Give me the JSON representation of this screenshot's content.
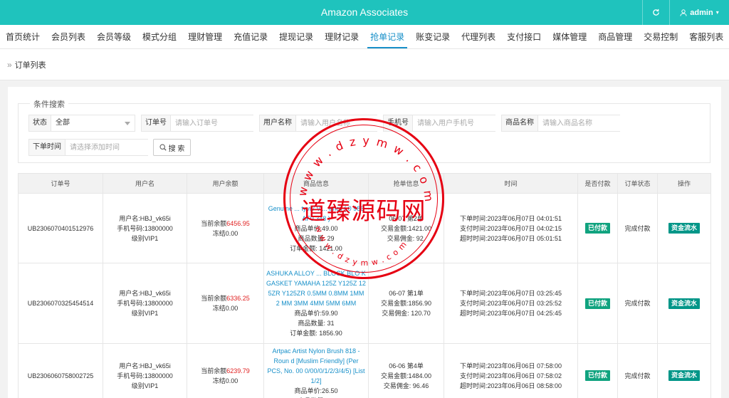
{
  "header": {
    "title": "Amazon Associates",
    "user": "admin"
  },
  "nav": [
    {
      "label": "首页统计"
    },
    {
      "label": "会员列表"
    },
    {
      "label": "会员等级"
    },
    {
      "label": "模式分组"
    },
    {
      "label": "理财管理"
    },
    {
      "label": "充值记录"
    },
    {
      "label": "提现记录"
    },
    {
      "label": "理财记录"
    },
    {
      "label": "抢单记录",
      "active": true
    },
    {
      "label": "账变记录"
    },
    {
      "label": "代理列表"
    },
    {
      "label": "支付接口"
    },
    {
      "label": "媒体管理"
    },
    {
      "label": "商品管理"
    },
    {
      "label": "交易控制"
    },
    {
      "label": "客服列表"
    }
  ],
  "breadcrumb": "订单列表",
  "search": {
    "legend": "条件搜索",
    "status_label": "状态",
    "status_value": "全部",
    "order_label": "订单号",
    "order_placeholder": "请输入订单号",
    "user_label": "用户名称",
    "user_placeholder": "请输入用户名称",
    "phone_label": "手机号",
    "phone_placeholder": "请输入用户手机号",
    "product_label": "商品名称",
    "product_placeholder": "请输入商品名称",
    "time_label": "下单时间",
    "time_placeholder": "请选择添加时间",
    "button": "搜 索"
  },
  "table": {
    "headers": [
      "订单号",
      "用户名",
      "用户余额",
      "商品信息",
      "抢单信息",
      "时间",
      "是否付款",
      "订单状态",
      "操作"
    ],
    "rows": [
      {
        "order_no": "UB2306070401512976",
        "user_name": "用户名:HBJ_vk65i",
        "user_phone": "手机号码:13800000",
        "user_level": "级别VIP1",
        "balance_label": "当前余额",
        "balance": "6456.95",
        "frozen": "冻结0.00",
        "product_title": "Genuine ... tyvi / Vi... ancil ( 0 986 AF0 348 )",
        "unit_price": "商品单价:49.00",
        "qty": "商品数量:  29",
        "amount": "订单金额:  1421.00",
        "grab_line1": "06-07 第2单",
        "grab_line2": "交易金额:1421.00",
        "grab_line3": "交易佣金:  92.",
        "t1": "下单时间:2023年06月07日 04:01:51",
        "t2": "支付时间:2023年06月07日 04:02:15",
        "t3": "超时时间:2023年06月07日 05:01:51",
        "paid": "已付款",
        "status": "完成付款",
        "action": "资金流水"
      },
      {
        "order_no": "UB2306070325454514",
        "user_name": "用户名:HBJ_vk65i",
        "user_phone": "手机号码:13800000",
        "user_level": "级别VIP1",
        "balance_label": "当前余额",
        "balance": "6336.25",
        "frozen": "冻结0.00",
        "product_title": "ASHUKA ALLOY ... BLOCK BLO K GASKET YAMAHA 125Z Y125Z 12 5ZR Y125ZR 0.5MM 0.8MM 1MM 2 MM 3MM 4MM 5MM 6MM",
        "unit_price": "商品单价:59.90",
        "qty": "商品数量:  31",
        "amount": "订单金额:  1856.90",
        "grab_line1": "06-07 第1单",
        "grab_line2": "交易金额:1856.90",
        "grab_line3": "交易佣金:  120.70",
        "t1": "下单时间:2023年06月07日 03:25:45",
        "t2": "支付时间:2023年06月07日 03:25:52",
        "t3": "超时时间:2023年06月07日 04:25:45",
        "paid": "已付款",
        "status": "完成付款",
        "action": "资金流水"
      },
      {
        "order_no": "UB2306060758002725",
        "user_name": "用户名:HBJ_vk65i",
        "user_phone": "手机号码:13800000",
        "user_level": "级别VIP1",
        "balance_label": "当前余额",
        "balance": "6239.79",
        "frozen": "冻结0.00",
        "product_title": "Artpac Artist Nylon Brush 818 - Roun d [Muslim Friendly] (Per PCS, No. 00 0/00/0/1/2/3/4/5) [List 1/2]",
        "unit_price": "商品单价:26.50",
        "qty": "商品数量:  56",
        "amount": "",
        "grab_line1": "06-06 第4单",
        "grab_line2": "交易金额:1484.00",
        "grab_line3": "交易佣金:  96.46",
        "t1": "下单时间:2023年06月06日 07:58:00",
        "t2": "支付时间:2023年06月06日 07:58:02",
        "t3": "超时时间:2023年06月06日 08:58:00",
        "paid": "已付款",
        "status": "完成付款",
        "action": "资金流水"
      }
    ]
  },
  "watermark": {
    "cn": "道臻源码网",
    "top_text": "w w w . d z y m w . c o m",
    "bottom_text": "w w w . d z y m w . c o m"
  },
  "colors": {
    "topbar": "#1fc3bd",
    "accent": "#1890c9",
    "badge": "#10a37f",
    "stamp": "#e60012"
  }
}
